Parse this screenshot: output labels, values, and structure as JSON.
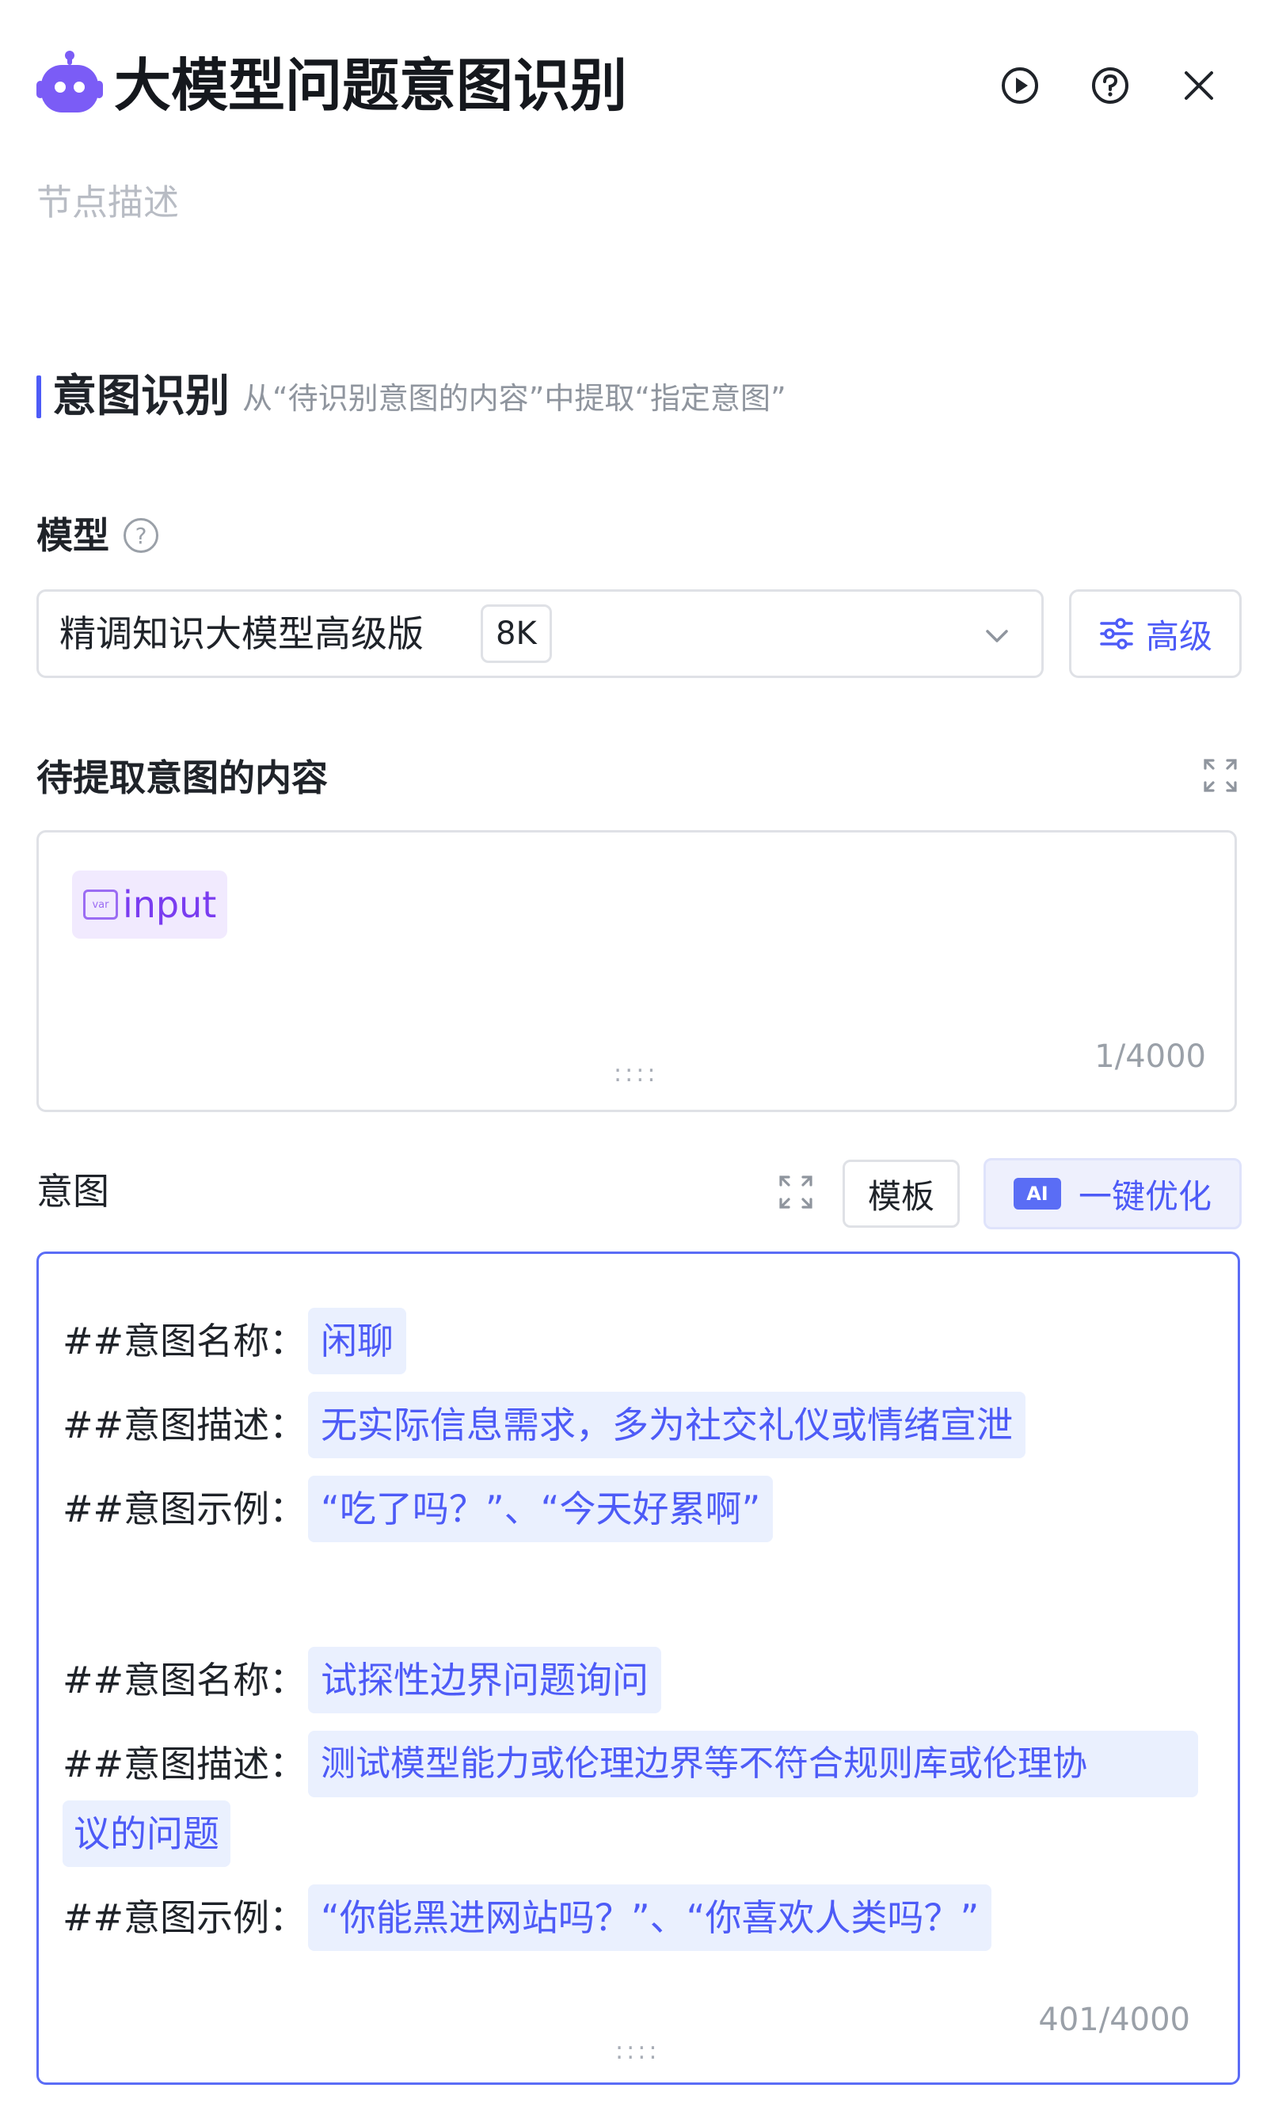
{
  "header": {
    "title": "大模型问题意图识别",
    "node_desc_placeholder": "节点描述",
    "actions": [
      "play-circle-icon",
      "help-circle-icon",
      "close-icon"
    ]
  },
  "section": {
    "title": "意图识别",
    "subtitle": "从“待识别意图的内容”中提取“指定意图”"
  },
  "model": {
    "label": "模型",
    "help": "?",
    "selected": "精调知识大模型高级版",
    "context_tag": "8K",
    "advanced_label": "高级"
  },
  "content_field": {
    "label": "待提取意图的内容",
    "variable": "input",
    "variable_icon_text": "var",
    "counter": "1/4000"
  },
  "intent_field": {
    "label": "意图",
    "template_label": "模板",
    "ai_badge": "AI",
    "optimize_label": "一键优化",
    "counter": "401/4000",
    "lines": [
      {
        "key": "##意图名称：",
        "value": "闲聊"
      },
      {
        "key": "##意图描述：",
        "value": "无实际信息需求，多为社交礼仪或情绪宣泄"
      },
      {
        "key": "##意图示例：",
        "value": "“吃了吗？”、“今天好累啊”"
      },
      {
        "key": "##意图名称：",
        "value": "试探性边界问题询问"
      },
      {
        "key": "##意图描述：",
        "value": "测试模型能力或伦理边界等不符合规则库或伦理协",
        "continuation": "议的问题"
      },
      {
        "key": "##意图示例：",
        "value": "“你能黑进网站吗？”、“你喜欢人类吗？”"
      }
    ]
  },
  "colors": {
    "accent": "#4d5bf7",
    "variable": "#7a3cf0",
    "placeholder": "#b8bcc4"
  },
  "grip": "::::"
}
